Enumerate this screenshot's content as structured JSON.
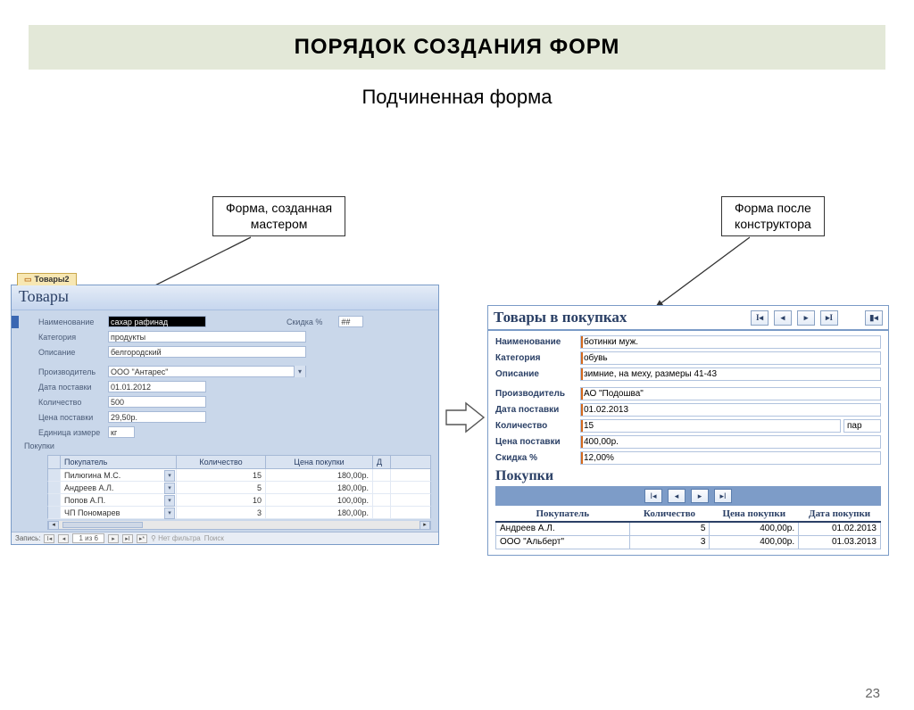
{
  "title": "ПОРЯДОК СОЗДАНИЯ ФОРМ",
  "subtitle": "Подчиненная форма",
  "slide_number": "23",
  "label_left": "Форма, созданная\nмастером",
  "label_right": "Форма после\nконструктора",
  "left": {
    "tab": "Товары2",
    "form_title": "Товары",
    "fields": {
      "name_label": "Наименование",
      "name_value": "сахар рафинад",
      "discount_label": "Скидка %",
      "discount_value": "##",
      "category_label": "Категория",
      "category_value": "продукты",
      "desc_label": "Описание",
      "desc_value": "белгородский",
      "maker_label": "Производитель",
      "maker_value": "ООО \"Антарес\"",
      "date_label": "Дата поставки",
      "date_value": "01.01.2012",
      "qty_label": "Количество",
      "qty_value": "500",
      "price_label": "Цена поставки",
      "price_value": "29,50р.",
      "unit_label": "Единица измере",
      "unit_value": "кг"
    },
    "sub_label": "Покупки",
    "sub_headers": {
      "buyer": "Покупатель",
      "qty": "Количество",
      "price": "Цена покупки",
      "d": "Д"
    },
    "sub_rows": [
      {
        "buyer": "Пилюгина М.С.",
        "qty": "15",
        "price": "180,00р."
      },
      {
        "buyer": "Андреев А.Л.",
        "qty": "5",
        "price": "180,00р."
      },
      {
        "buyer": "Попов А.П.",
        "qty": "10",
        "price": "100,00р."
      },
      {
        "buyer": "ЧП Пономарев",
        "qty": "3",
        "price": "180,00р."
      }
    ],
    "footer": {
      "label": "Запись:",
      "pos": "1 из 6",
      "filter": "Нет фильтра",
      "search": "Поиск"
    }
  },
  "right": {
    "form_title": "Товары в покупках",
    "fields": {
      "name_label": "Наименование",
      "name_value": "ботинки муж.",
      "category_label": "Категория",
      "category_value": "обувь",
      "desc_label": "Описание",
      "desc_value": "зимние, на меху, размеры 41-43",
      "maker_label": "Производитель",
      "maker_value": "АО \"Подошва\"",
      "date_label": "Дата поставки",
      "date_value": "01.02.2013",
      "qty_label": "Количество",
      "qty_value": "15",
      "qty_unit": "пар",
      "price_label": "Цена поставки",
      "price_value": "400,00р.",
      "discount_label": "Скидка %",
      "discount_value": "12,00%"
    },
    "sub_title": "Покупки",
    "sub_headers": {
      "buyer": "Покупатель",
      "qty": "Количество",
      "price": "Цена покупки",
      "date": "Дата покупки"
    },
    "sub_rows": [
      {
        "buyer": "Андреев А.Л.",
        "qty": "5",
        "price": "400,00р.",
        "date": "01.02.2013"
      },
      {
        "buyer": "ООО \"Альберт\"",
        "qty": "3",
        "price": "400,00р.",
        "date": "01.03.2013"
      }
    ]
  }
}
